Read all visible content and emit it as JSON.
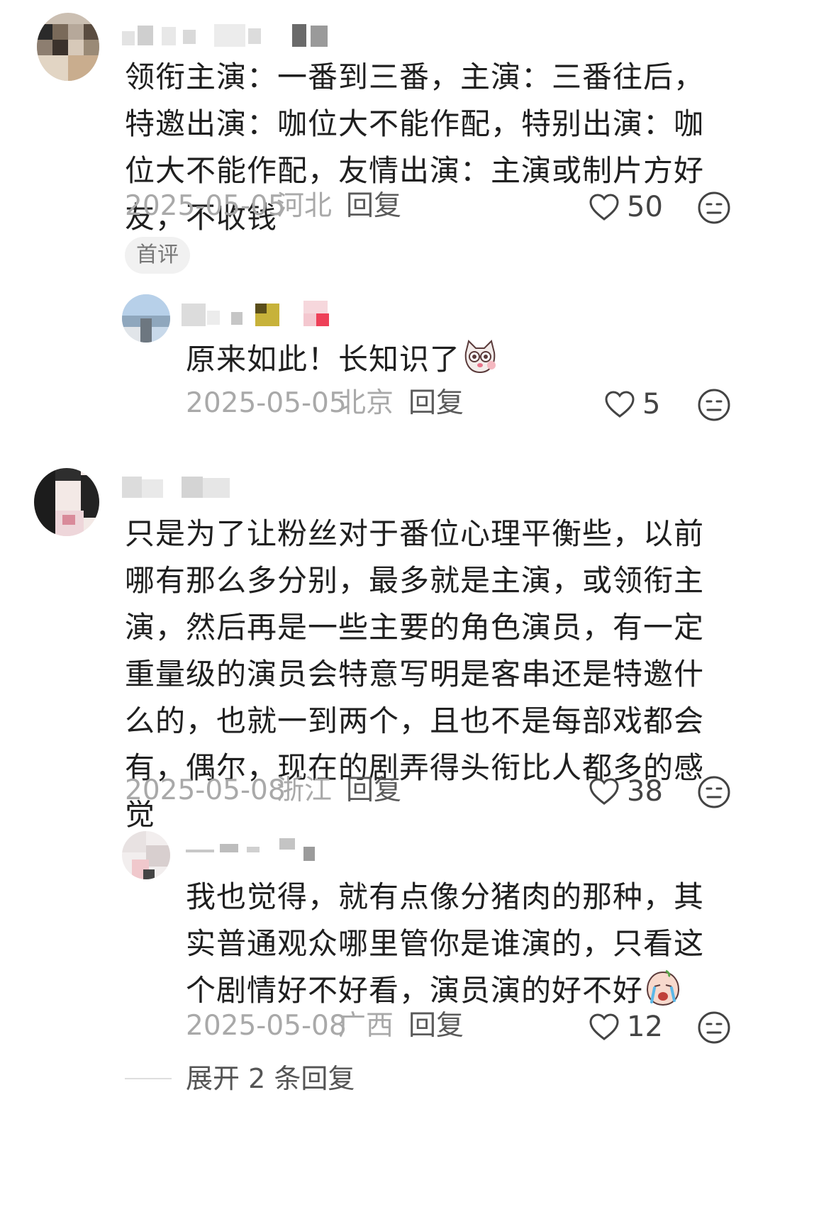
{
  "comments": [
    {
      "text": "领衔主演：一番到三番，主演：三番往后，特邀出演：咖位大不能作配，特别出演：咖位大不能作配，友情出演：主演或制片方好友，不收钱",
      "date": "2025-05-05",
      "location": "河北",
      "reply_label": "回复",
      "likes": "50",
      "tag": "首评",
      "replies": [
        {
          "text": "原来如此！长知识了",
          "emoji": "surprised-cat-emoji",
          "date": "2025-05-05",
          "location": "北京",
          "reply_label": "回复",
          "likes": "5"
        }
      ]
    },
    {
      "text": "只是为了让粉丝对于番位心理平衡些，以前哪有那么多分别，最多就是主演，或领衔主演，然后再是一些主要的角色演员，有一定重量级的演员会特意写明是客串还是特邀什么的，也就一到两个，且也不是每部戏都会有，偶尔，现在的剧弄得头衔比人都多的感觉",
      "date": "2025-05-08",
      "location": "浙江",
      "reply_label": "回复",
      "likes": "38",
      "replies": [
        {
          "text": "我也觉得，就有点像分猪肉的那种，其实普通观众哪里管你是谁演的，只看这个剧情好不好看，演员演的好不好",
          "emoji": "crying-face-emoji",
          "date": "2025-05-08",
          "location": "广西",
          "reply_label": "回复",
          "likes": "12"
        }
      ],
      "expand_label": "展开 2 条回复"
    }
  ],
  "icons": {
    "like": "heart-outline-icon",
    "dislike": "neutral-face-icon"
  },
  "colors": {
    "meta_gray": "#a9a9a9",
    "text_dark": "#1f1f1f"
  }
}
